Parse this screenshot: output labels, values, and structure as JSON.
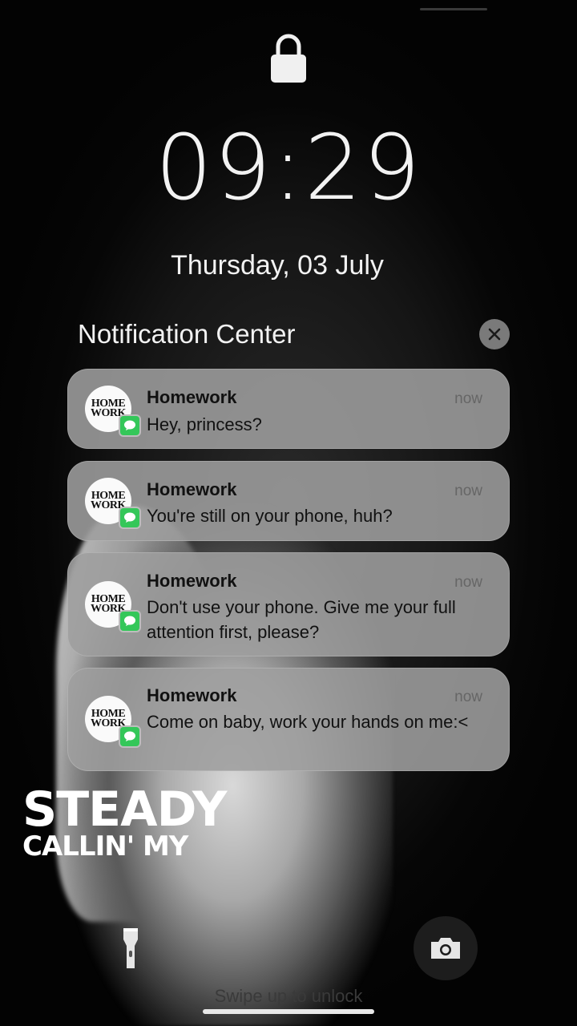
{
  "lock_screen": {
    "time": "09:29",
    "date": "Thursday, 03 July"
  },
  "notification_center": {
    "title": "Notification Center",
    "notifications": [
      {
        "app": "Homework",
        "avatar_line1": "HOME",
        "avatar_line2": "WORK",
        "time": "now",
        "message": "Hey, princess?"
      },
      {
        "app": "Homework",
        "avatar_line1": "HOME",
        "avatar_line2": "WORK",
        "time": "now",
        "message": "You're still on your phone, huh?"
      },
      {
        "app": "Homework",
        "avatar_line1": "HOME",
        "avatar_line2": "WORK",
        "time": "now",
        "message": "Don't use your phone. Give me your full attention first, please?"
      },
      {
        "app": "Homework",
        "avatar_line1": "HOME",
        "avatar_line2": "WORK",
        "time": "now",
        "message": "Come on baby, work your hands on me:<"
      }
    ]
  },
  "overlay": {
    "line1": "STEADY",
    "line2": "CALLIN' MY"
  },
  "footer": {
    "swipe_hint": "Swipe up to unlock"
  },
  "icons": {
    "lock": "lock-icon",
    "close": "close-icon",
    "messages_badge": "messages-icon",
    "flashlight": "flashlight-icon",
    "camera": "camera-icon"
  },
  "colors": {
    "badge": "#34c759",
    "notification_bg": "#9e9e9e"
  }
}
